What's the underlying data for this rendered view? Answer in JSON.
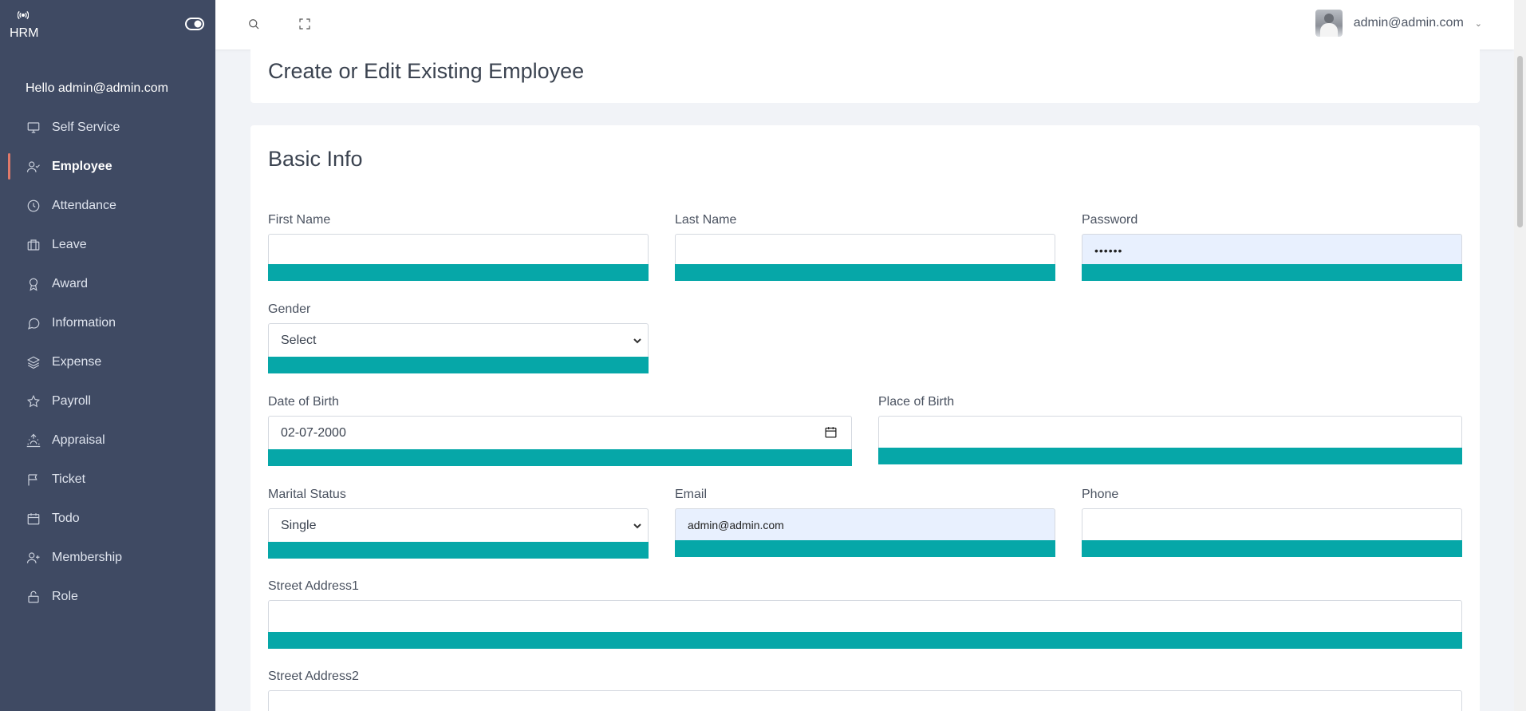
{
  "brand": {
    "name": "HRM"
  },
  "sidebar": {
    "greeting": "Hello admin@admin.com",
    "items": [
      {
        "label": "Self Service",
        "icon": "monitor-icon"
      },
      {
        "label": "Employee",
        "icon": "user-check-icon",
        "active": true
      },
      {
        "label": "Attendance",
        "icon": "clock-icon"
      },
      {
        "label": "Leave",
        "icon": "briefcase-icon"
      },
      {
        "label": "Award",
        "icon": "award-icon"
      },
      {
        "label": "Information",
        "icon": "message-circle-icon"
      },
      {
        "label": "Expense",
        "icon": "layers-icon"
      },
      {
        "label": "Payroll",
        "icon": "star-icon"
      },
      {
        "label": "Appraisal",
        "icon": "sunrise-icon"
      },
      {
        "label": "Ticket",
        "icon": "flag-icon"
      },
      {
        "label": "Todo",
        "icon": "calendar-icon"
      },
      {
        "label": "Membership",
        "icon": "user-plus-icon"
      },
      {
        "label": "Role",
        "icon": "unlock-icon"
      }
    ]
  },
  "topbar": {
    "user_email": "admin@admin.com"
  },
  "page": {
    "title": "Create or Edit Existing Employee",
    "section_title": "Basic Info"
  },
  "form": {
    "first_name": {
      "label": "First Name",
      "value": ""
    },
    "last_name": {
      "label": "Last Name",
      "value": ""
    },
    "password": {
      "label": "Password",
      "value": "••••••"
    },
    "gender": {
      "label": "Gender",
      "value": "Select"
    },
    "date_of_birth": {
      "label": "Date of Birth",
      "value": "02-07-2000"
    },
    "place_of_birth": {
      "label": "Place of Birth",
      "value": ""
    },
    "marital_status": {
      "label": "Marital Status",
      "value": "Single"
    },
    "email": {
      "label": "Email",
      "value": "admin@admin.com"
    },
    "phone": {
      "label": "Phone",
      "value": ""
    },
    "street_address1": {
      "label": "Street Address1",
      "value": ""
    },
    "street_address2": {
      "label": "Street Address2",
      "value": ""
    }
  },
  "colors": {
    "sidebar_bg": "#3f4a63",
    "accent_bar": "#06a7a8",
    "active_indicator": "#e0796a",
    "autofill_bg": "#e8f0fe"
  }
}
